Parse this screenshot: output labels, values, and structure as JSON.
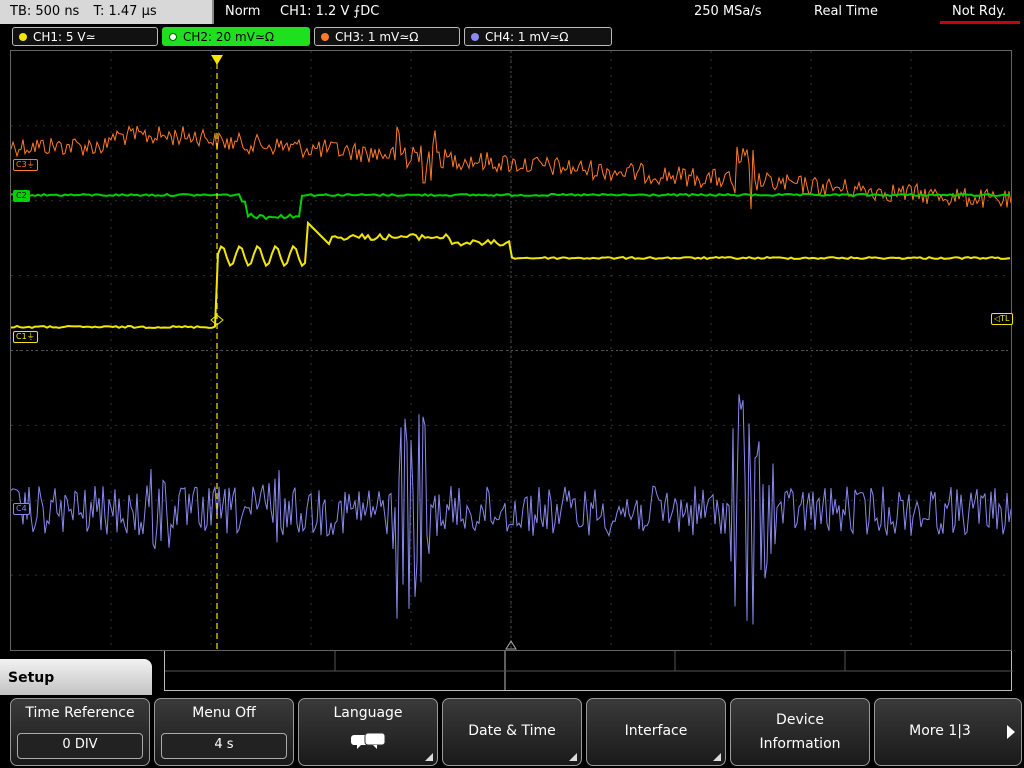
{
  "status": {
    "timebase": "TB: 500 ns",
    "trigger_time": "T: 1.47 µs",
    "mode": "Norm",
    "trigger": "CH1: 1.2 V ⨍DC",
    "sample_rate": "250 MSa/s",
    "acq_mode": "Real Time",
    "ready": "Not Rdy."
  },
  "channels": [
    {
      "label": "CH1: 5 V≃",
      "color": "#f3e600"
    },
    {
      "label": "CH2: 20 mV≃Ω",
      "color": "#00d000"
    },
    {
      "label": "CH3: 1 mV≃Ω",
      "color": "#ff7a2a"
    },
    {
      "label": "CH4: 1 mV≃Ω",
      "color": "#8888ee"
    }
  ],
  "markers": {
    "c1": "C1",
    "c2": "C2",
    "c3": "C3",
    "c4": "C4",
    "trigger_level": "TL",
    "trigger_pos": "T"
  },
  "menu": {
    "title": "Setup",
    "time_reference": {
      "label": "Time Reference",
      "value": "0 DIV"
    },
    "menu_off": {
      "label": "Menu Off",
      "value": "4 s"
    },
    "language": {
      "label": "Language"
    },
    "date_time": {
      "label": "Date & Time"
    },
    "interface": {
      "label": "Interface"
    },
    "device_info": {
      "line1": "Device",
      "line2": "Information"
    },
    "more": {
      "label": "More 1|3"
    }
  }
}
